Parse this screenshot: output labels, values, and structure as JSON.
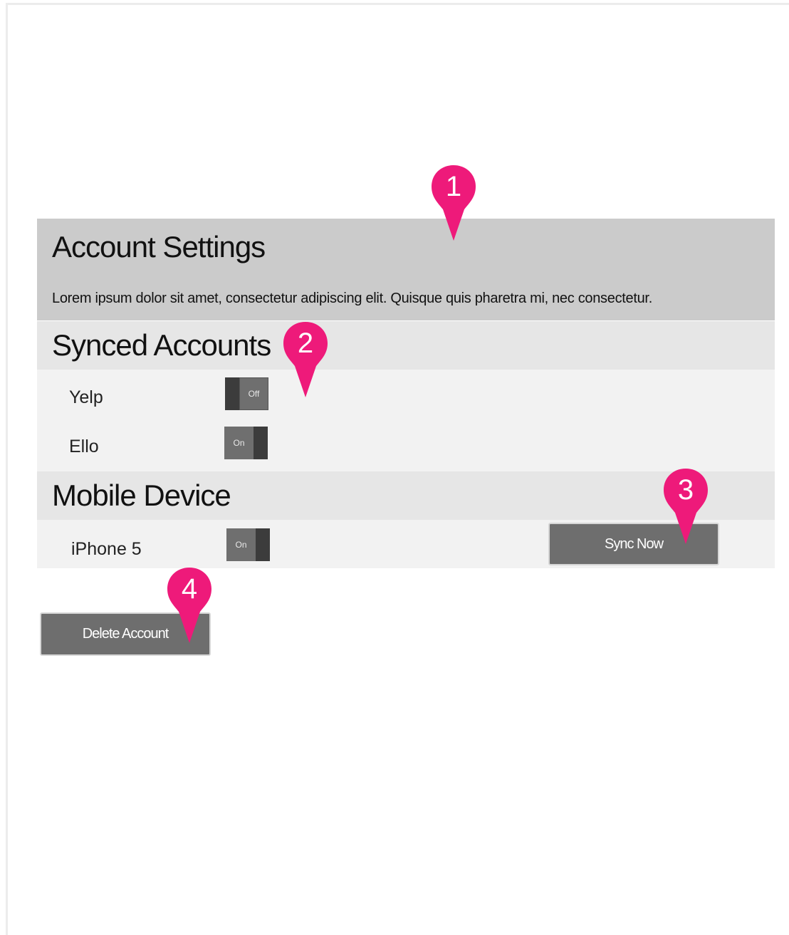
{
  "header": {
    "title": "Account Settings",
    "description": "Lorem ipsum dolor sit amet, consectetur adipiscing elit. Quisque quis pharetra mi, nec consectetur."
  },
  "synced_accounts": {
    "heading": "Synced Accounts",
    "items": [
      {
        "label": "Yelp",
        "toggle": "Off"
      },
      {
        "label": "Ello",
        "toggle": "On"
      }
    ]
  },
  "mobile_device": {
    "heading": "Mobile Device",
    "device": {
      "label": "iPhone 5",
      "toggle": "On"
    },
    "sync_button": "Sync Now"
  },
  "delete_button": "Delete Account",
  "markers": [
    "1",
    "2",
    "3",
    "4"
  ],
  "colors": {
    "marker": "#ee1a7a",
    "header_bg": "#cbcbcb",
    "section_head_bg": "#e6e6e6",
    "section_body_bg": "#f2f2f2",
    "button_bg": "#6e6e6e",
    "toggle_dark": "#3c3c3c",
    "toggle_face": "#6f6f6f"
  }
}
